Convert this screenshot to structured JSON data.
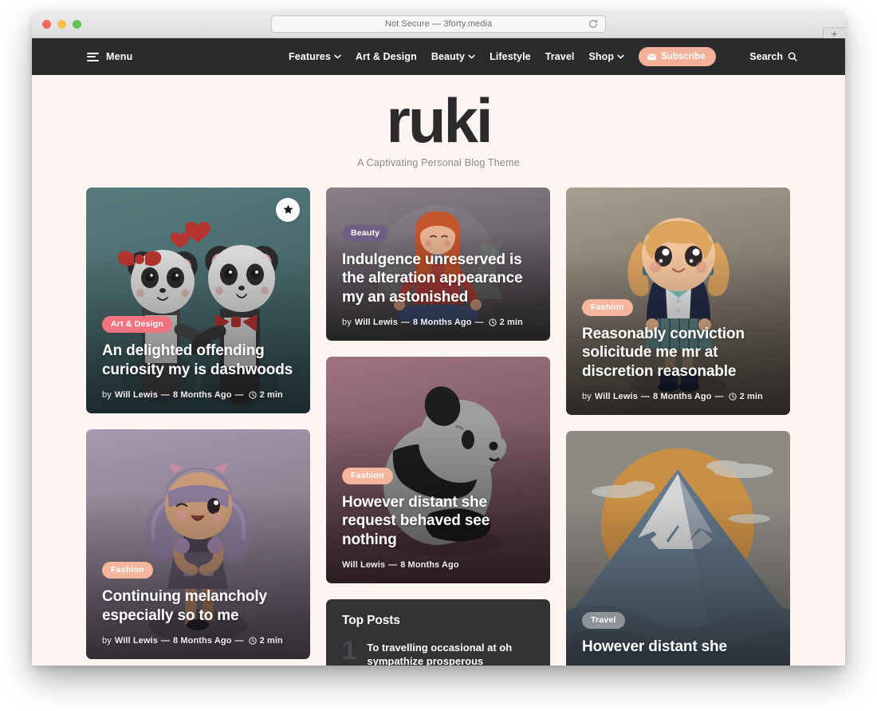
{
  "browser": {
    "url_text": "Not Secure — 3forty.media",
    "reload_label": "↻",
    "newtab_label": "+"
  },
  "nav": {
    "menu_label": "Menu",
    "items": [
      {
        "label": "Features",
        "has_caret": true
      },
      {
        "label": "Art & Design",
        "has_caret": false
      },
      {
        "label": "Beauty",
        "has_caret": true
      },
      {
        "label": "Lifestyle",
        "has_caret": false
      },
      {
        "label": "Travel",
        "has_caret": false
      },
      {
        "label": "Shop",
        "has_caret": true
      }
    ],
    "subscribe_label": "Subscribe",
    "search_label": "Search",
    "bg_color": "#2b2b2e",
    "subscribe_color": "#f3b199"
  },
  "brand": {
    "logo": "ruki",
    "tagline": "A Captivating Personal Blog Theme"
  },
  "cards": {
    "pandas": {
      "badge": "Art & Design",
      "badge_color": "#f0737f",
      "title": "An delighted offending curiosity my is dashwoods",
      "meta_prefix": "by",
      "author": "Will Lewis",
      "date": "8 Months Ago",
      "readtime": "2 min"
    },
    "beauty": {
      "badge": "Beauty",
      "badge_color": "#6f5f86",
      "title": "Indulgence unreserved is the alteration appearance my an astonished",
      "meta_prefix": "by",
      "author": "Will Lewis",
      "date": "8 Months Ago",
      "readtime": "2 min"
    },
    "schoolgirl": {
      "badge": "Fashion",
      "badge_color": "#f4b79d",
      "title": "Reasonably conviction solicitude me mr at discretion reasonable",
      "meta_prefix": "by",
      "author": "Will Lewis",
      "date": "8 Months Ago",
      "readtime": "2 min"
    },
    "purplegirl": {
      "badge": "Fashion",
      "badge_color": "#f4b79d",
      "title": "Continuing melancholy especially so to me",
      "meta_prefix": "by",
      "author": "Will Lewis",
      "date": "8 Months Ago",
      "readtime": "2 min"
    },
    "panda2": {
      "badge": "Fashion",
      "badge_color": "#f4b79d",
      "title": "However distant she request behaved see nothing",
      "author": "Will Lewis",
      "date": "8 Months Ago"
    },
    "travel": {
      "badge": "Travel",
      "badge_color": "#8e9299",
      "title": "However distant she"
    }
  },
  "widget": {
    "title": "Top Posts",
    "posts": [
      {
        "number": "1",
        "title": "To travelling occasional at oh sympathize prosperous"
      }
    ]
  },
  "theme": {
    "page_bg": "#fdf5f2",
    "dark": "#2b2b2e"
  }
}
